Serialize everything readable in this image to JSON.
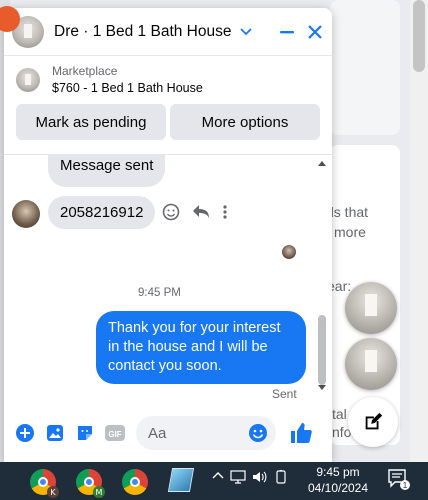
{
  "background": {
    "snippet_1": "ds that",
    "snippet_2": "more",
    "snippet_3": "ear:",
    "snippet_4": "tal",
    "snippet_5": "nfor"
  },
  "chat": {
    "title": "Dre · 1 Bed 1 Bath House",
    "listing": {
      "category": "Marketplace",
      "summary": "$760 - 1 Bed 1 Bath House"
    },
    "actions": {
      "mark_pending": "Mark as pending",
      "more_options": "More options"
    },
    "messages": {
      "system_sent": "Message sent",
      "incoming_number": "2058216912",
      "timestamp": "9:45 PM",
      "outgoing_text": "Thank you for your interest in the house and I will be contact you soon.",
      "status": "Sent"
    },
    "composer": {
      "placeholder": "Aa",
      "gif_label": "GIF"
    }
  },
  "taskbar": {
    "time": "9:45 pm",
    "date": "04/10/2024",
    "notification_count": "1",
    "chrome_badges": [
      "K",
      "M"
    ]
  },
  "colors": {
    "messenger_blue": "#1877f2",
    "taskbar": "#1f2c3a"
  }
}
